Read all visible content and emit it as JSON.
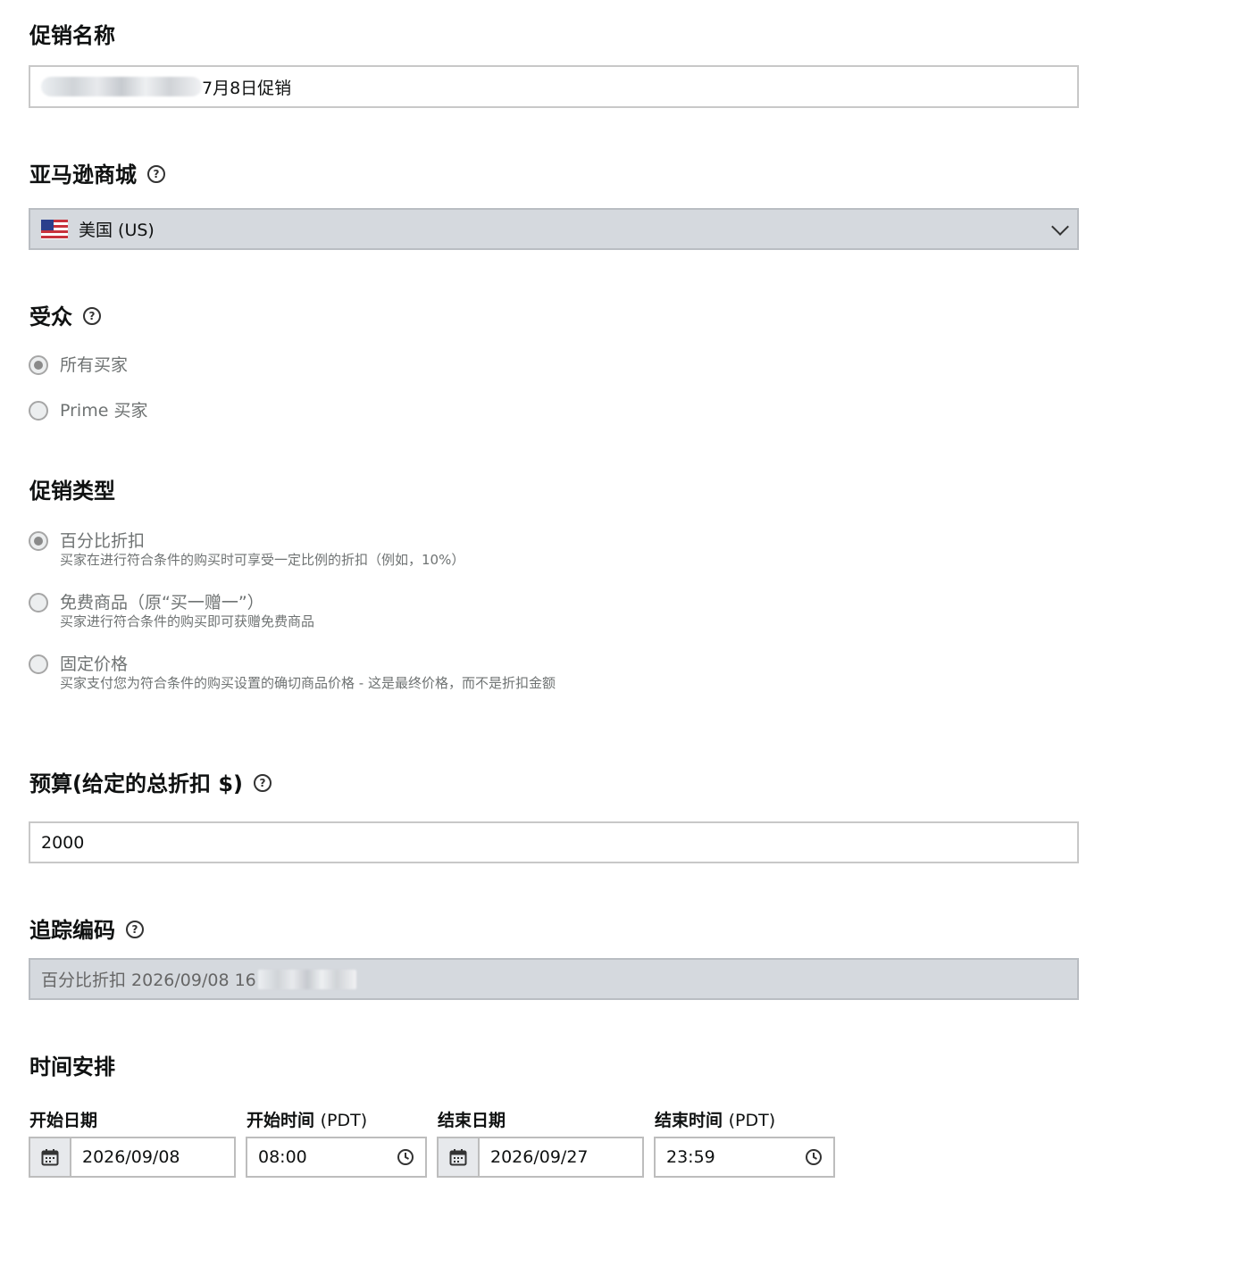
{
  "promo_name": {
    "label": "促销名称",
    "value_suffix": "7月8日促销"
  },
  "marketplace": {
    "label": "亚马逊商城",
    "help_icon": "help-circle-icon",
    "flag_icon": "us-flag-icon",
    "selected": "美国 (US)"
  },
  "audience": {
    "label": "受众",
    "help_icon": "help-circle-icon",
    "options": [
      {
        "label": "所有买家",
        "checked": true
      },
      {
        "label": "Prime 买家",
        "checked": false
      }
    ]
  },
  "promo_type": {
    "label": "促销类型",
    "options": [
      {
        "label": "百分比折扣",
        "desc": "买家在进行符合条件的购买时可享受一定比例的折扣（例如，10%）",
        "checked": true
      },
      {
        "label": "免费商品（原“买一赠一”）",
        "desc": "买家进行符合条件的购买即可获赠免费商品",
        "checked": false
      },
      {
        "label": "固定价格",
        "desc": "买家支付您为符合条件的购买设置的确切商品价格 - 这是最终价格，而不是折扣金额",
        "checked": false
      }
    ]
  },
  "budget": {
    "label": "预算(给定的总折扣 $)",
    "help_icon": "help-circle-icon",
    "value": "2000"
  },
  "tracking": {
    "label": "追踪编码",
    "help_icon": "help-circle-icon",
    "value_prefix": "百分比折扣 2026/09/08 16"
  },
  "schedule": {
    "label": "时间安排",
    "start_date_label": "开始日期",
    "start_time_label": "开始时间",
    "start_time_unit": "(PDT)",
    "end_date_label": "结束日期",
    "end_time_label": "结束时间",
    "end_time_unit": "(PDT)",
    "start_date": "2026/09/08",
    "start_time": "08:00",
    "end_date": "2026/09/27",
    "end_time": "23:59",
    "calendar_icon": "calendar-icon",
    "clock_icon": "clock-icon"
  }
}
